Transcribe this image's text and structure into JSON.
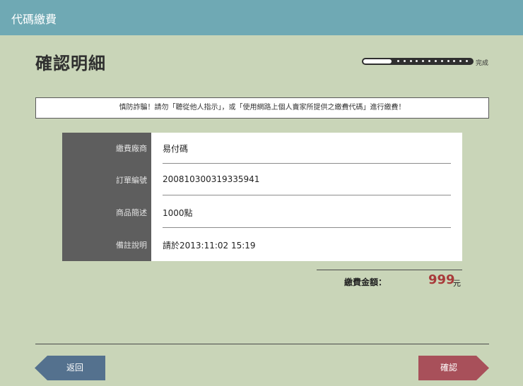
{
  "header": {
    "title": "代碼繳費"
  },
  "page": {
    "title": "確認明細"
  },
  "progress": {
    "label": "完成",
    "fraction": 1.0
  },
  "notice": {
    "text": "慎防詐騙！請勿「聽從他人指示」，或「使用網路上個人賣家所提供之繳費代碼」進行繳費！"
  },
  "details": {
    "rows": [
      {
        "label": "繳費廠商",
        "value": "易付碼"
      },
      {
        "label": "訂單編號",
        "value": "20081030031933594​1"
      },
      {
        "label": "商品簡述",
        "value": "1000點"
      },
      {
        "label": "備註說明",
        "value": "請於2013:11:02 15:19"
      }
    ]
  },
  "amount": {
    "label": "繳費金額：",
    "value": "999",
    "unit": "元"
  },
  "buttons": {
    "back": "返回",
    "confirm": "確認"
  },
  "colors": {
    "topbar": "#6fa9b4",
    "background": "#c9d5b8",
    "amount": "#a83a3a",
    "back": "#54718e",
    "confirm": "#a8505a"
  }
}
